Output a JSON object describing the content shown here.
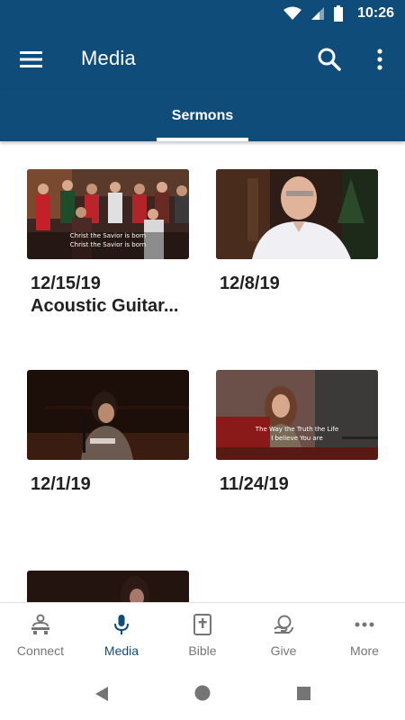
{
  "status_bar": {
    "time": "10:26"
  },
  "app_bar": {
    "title": "Media"
  },
  "tabs": [
    {
      "label": "Sermons",
      "selected": true
    }
  ],
  "sermons": [
    {
      "date": "12/15/19",
      "title": "Acoustic Guitar...",
      "lyrics": [
        "Christ the Savior is born",
        "Christ the Savior is born"
      ]
    },
    {
      "date": "12/8/19",
      "title": ""
    },
    {
      "date": "12/1/19",
      "title": ""
    },
    {
      "date": "11/24/19",
      "title": "",
      "lyrics": [
        "The Way the Truth the Life",
        "I believe You are"
      ]
    }
  ],
  "bottom_nav": [
    {
      "label": "Connect",
      "icon": "connect-icon",
      "active": false
    },
    {
      "label": "Media",
      "icon": "microphone-icon",
      "active": true
    },
    {
      "label": "Bible",
      "icon": "bible-icon",
      "active": false
    },
    {
      "label": "Give",
      "icon": "give-icon",
      "active": false
    },
    {
      "label": "More",
      "icon": "more-horizontal-icon",
      "active": false
    }
  ],
  "colors": {
    "primary": "#0f4c79",
    "inactive": "#757575"
  }
}
